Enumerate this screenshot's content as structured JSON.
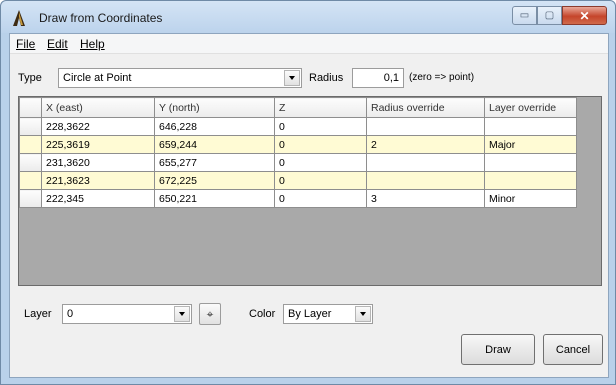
{
  "window": {
    "title": "Draw from Coordinates",
    "caption_min": "▭",
    "caption_max": "▢",
    "caption_close": "✕"
  },
  "menu": [
    "File",
    "Edit",
    "Help"
  ],
  "type": {
    "label": "Type",
    "value": "Circle at Point"
  },
  "radius": {
    "label": "Radius",
    "value": "0,1",
    "hint": "(zero => point)"
  },
  "table": {
    "columns": [
      "X (east)",
      "Y (north)",
      "Z",
      "Radius override",
      "Layer override"
    ],
    "rows": [
      [
        "228,3622",
        "646,228",
        "0",
        "",
        ""
      ],
      [
        "225,3619",
        "659,244",
        "0",
        "2",
        "Major"
      ],
      [
        "231,3620",
        "655,277",
        "0",
        "",
        ""
      ],
      [
        "221,3623",
        "672,225",
        "0",
        "",
        ""
      ],
      [
        "222,345",
        "650,221",
        "0",
        "3",
        "Minor"
      ]
    ]
  },
  "layer": {
    "label": "Layer",
    "value": "0",
    "pick_glyph": "⌖"
  },
  "color": {
    "label": "Color",
    "value": "By Layer"
  },
  "buttons": {
    "draw": "Draw",
    "cancel": "Cancel"
  },
  "colors": {
    "row_highlight": "#fffbd4",
    "grid_background": "#a9a9a9",
    "window_frame": "#b9d1ea",
    "close_button": "#c5452b"
  },
  "icons": {
    "app": "survey-tripod-icon",
    "pick": "crosshair-icon",
    "dropdown": "chevron-down-icon"
  }
}
